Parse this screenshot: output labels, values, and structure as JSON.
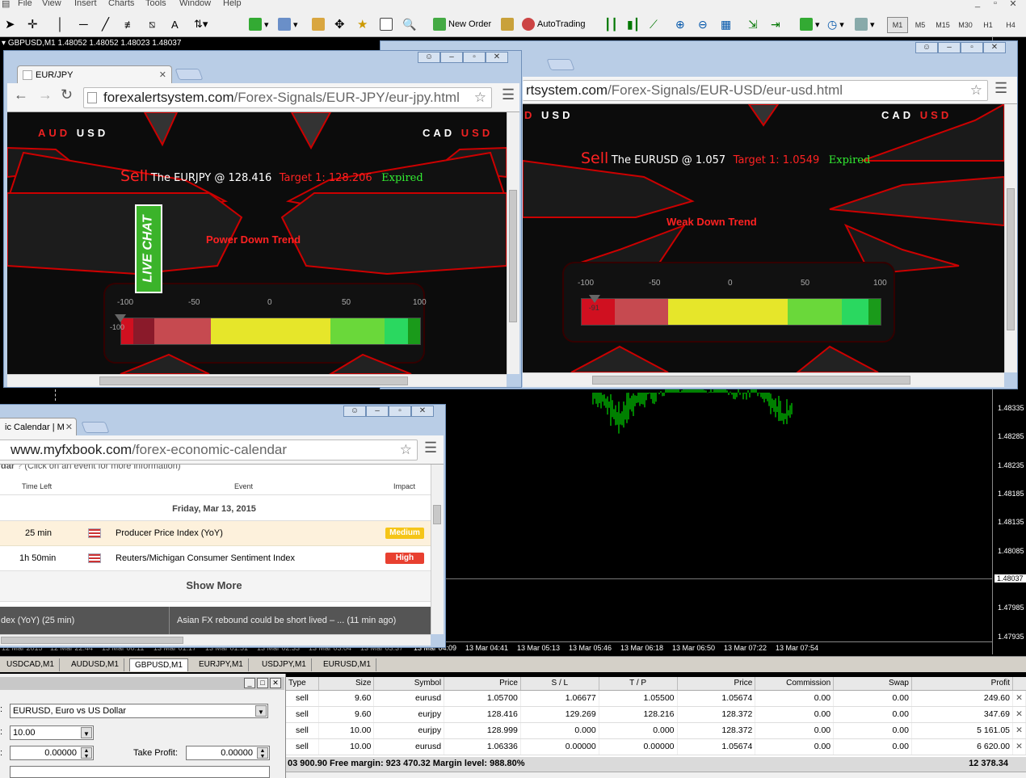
{
  "menu": [
    "File",
    "View",
    "Insert",
    "Charts",
    "Tools",
    "Window",
    "Help"
  ],
  "toolbar": {
    "new_order": "New Order",
    "auto_trading": "AutoTrading",
    "timeframes": [
      "M1",
      "M5",
      "M15",
      "M30",
      "H1",
      "H4"
    ],
    "active_timeframe": "M1"
  },
  "chart": {
    "info": "GBPUSD,M1  1.48052 1.48052 1.48023 1.48037",
    "price_labels": [
      "1.48335",
      "1.48285",
      "1.48235",
      "1.48185",
      "1.48135",
      "1.48085",
      "1.48037",
      "1.47985",
      "1.47935"
    ],
    "current_price": "1.48037",
    "time_labels_left": [
      "12 Mar 2015",
      "12 Mar 22:44",
      "13 Mar 00:11",
      "13 Mar 01:17",
      "13 Mar 01:51",
      "13 Mar 02:33",
      "13 Mar 03:04",
      "13 Mar 03:37"
    ],
    "time_labels_right": [
      "13 Mar 04:09",
      "13 Mar 04:41",
      "13 Mar 05:13",
      "13 Mar 05:46",
      "13 Mar 06:18",
      "13 Mar 06:50",
      "13 Mar 07:22",
      "13 Mar 07:54"
    ],
    "candle_color": "#00ff00"
  },
  "chart_tabs": [
    "USDCAD,M1",
    "AUDUSD,M1",
    "GBPUSD,M1",
    "EURJPY,M1",
    "USDJPY,M1",
    "EURUSD,M1"
  ],
  "active_chart_tab": "GBPUSD,M1",
  "browser1": {
    "tab_title": "EUR/JPY",
    "url_host": "forexalertsystem.com",
    "url_path": "/Forex-Signals/EUR-JPY/eur-jpy.html",
    "left_pair": [
      "AUD",
      "USD"
    ],
    "right_pair": [
      "CAD",
      "USD"
    ],
    "signal": {
      "action": "Sell",
      "text": "The EURJPY @ 128.416",
      "target": "Target 1: 128.206",
      "status": "Expired"
    },
    "trend": "Power Down Trend",
    "live_chat": "LIVE CHAT",
    "scale": [
      "-100",
      "-50",
      "0",
      "50",
      "100"
    ],
    "pointer_value": "-100",
    "pointer_level": -100
  },
  "browser2": {
    "url_host": "rtsystem.com",
    "url_path": "/Forex-Signals/EUR-USD/eur-usd.html",
    "left_pair": [
      "D",
      "USD"
    ],
    "right_pair": [
      "CAD",
      "USD"
    ],
    "signal": {
      "action": "Sell",
      "text": "The EURUSD @ 1.057",
      "target": "Target 1: 1.0549",
      "status": "Expired"
    },
    "trend": "Weak Down Trend",
    "scale": [
      "-100",
      "-50",
      "0",
      "50",
      "100"
    ],
    "pointer_value": "-91",
    "pointer_level": -91
  },
  "browser3": {
    "tab_title": "ic Calendar | M",
    "url_host": "www.myfxbook.com",
    "url_path": "/forex-economic-calendar",
    "clipped_header": "dar",
    "hint": "(Click on an event for more information)",
    "cols": [
      "Time Left",
      "Event",
      "Impact"
    ],
    "date": "Friday, Mar 13, 2015",
    "events": [
      {
        "time": "25 min",
        "event": "Producer Price Index (YoY)",
        "impact": "Medium",
        "impact_color": "#f5c518"
      },
      {
        "time": "1h 50min",
        "event": "Reuters/Michigan Consumer Sentiment Index",
        "impact": "High",
        "impact_color": "#e84030"
      }
    ],
    "show_more": "Show More",
    "ticker_left": "dex (YoY) (25 min)",
    "ticker_right": "Asian FX rebound could be short lived – ...  (11 min ago)"
  },
  "order_panel": {
    "symbol": "EURUSD, Euro vs US Dollar",
    "volume": "10.00",
    "stop_loss": "0.00000",
    "take_profit_label": "Take Profit:",
    "take_profit": "0.00000"
  },
  "trades": {
    "columns": [
      "Type",
      "Size",
      "Symbol",
      "Price",
      "S / L",
      "T / P",
      "Price",
      "Commission",
      "Swap",
      "Profit"
    ],
    "rows": [
      [
        "sell",
        "9.60",
        "eurusd",
        "1.05700",
        "1.06677",
        "1.05500",
        "1.05674",
        "0.00",
        "0.00",
        "249.60"
      ],
      [
        "sell",
        "9.60",
        "eurjpy",
        "128.416",
        "129.269",
        "128.216",
        "128.372",
        "0.00",
        "0.00",
        "347.69"
      ],
      [
        "sell",
        "10.00",
        "eurjpy",
        "128.999",
        "0.000",
        "0.000",
        "128.372",
        "0.00",
        "0.00",
        "5 161.05"
      ],
      [
        "sell",
        "10.00",
        "eurusd",
        "1.06336",
        "0.00000",
        "0.00000",
        "1.05674",
        "0.00",
        "0.00",
        "6 620.00"
      ]
    ],
    "summary": "03 900.90  Free margin: 923 470.32  Margin level: 988.80%",
    "total_profit": "12 378.34"
  }
}
